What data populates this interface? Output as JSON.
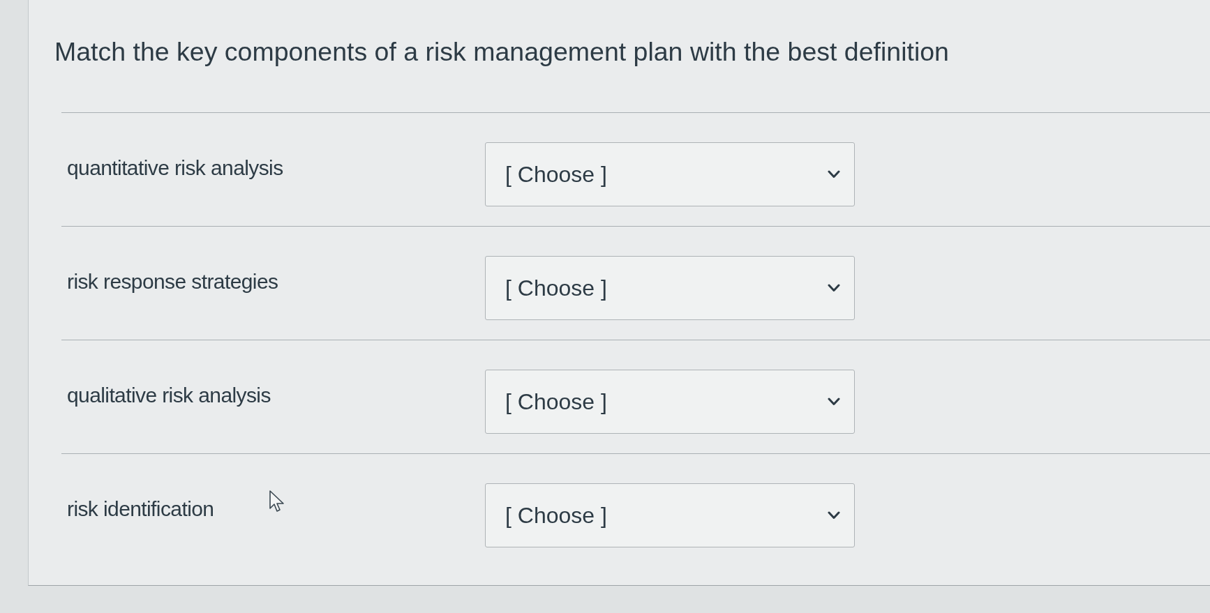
{
  "question": {
    "prompt": "Match the key components of a risk management plan with the best definition"
  },
  "matches": [
    {
      "term": "quantitative risk analysis",
      "answer": {
        "value": "[ Choose ]"
      }
    },
    {
      "term": "risk response strategies",
      "answer": {
        "value": "[ Choose ]"
      }
    },
    {
      "term": "qualitative risk analysis",
      "answer": {
        "value": "[ Choose ]"
      }
    },
    {
      "term": "risk identification",
      "answer": {
        "value": "[ Choose ]"
      }
    }
  ]
}
